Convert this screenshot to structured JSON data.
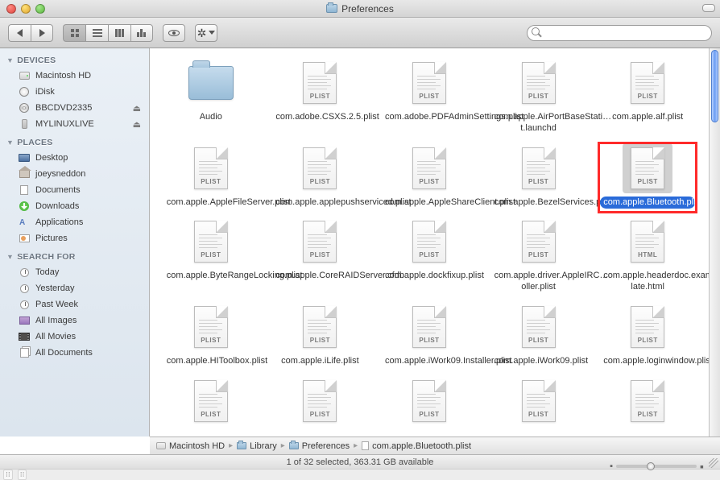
{
  "window": {
    "title": "Preferences"
  },
  "search": {
    "placeholder": ""
  },
  "sidebar": {
    "sections": [
      {
        "title": "DEVICES",
        "items": [
          {
            "label": "Macintosh HD",
            "icon": "hd",
            "eject": false
          },
          {
            "label": "iDisk",
            "icon": "idisk",
            "eject": false
          },
          {
            "label": "BBCDVD2335",
            "icon": "disc",
            "eject": true
          },
          {
            "label": "MYLINUXLIVE",
            "icon": "thumb",
            "eject": true
          }
        ]
      },
      {
        "title": "PLACES",
        "items": [
          {
            "label": "Desktop",
            "icon": "desktop"
          },
          {
            "label": "joeysneddon",
            "icon": "home"
          },
          {
            "label": "Documents",
            "icon": "docs"
          },
          {
            "label": "Downloads",
            "icon": "dl"
          },
          {
            "label": "Applications",
            "icon": "app"
          },
          {
            "label": "Pictures",
            "icon": "pic"
          }
        ]
      },
      {
        "title": "SEARCH FOR",
        "items": [
          {
            "label": "Today",
            "icon": "clock"
          },
          {
            "label": "Yesterday",
            "icon": "clock"
          },
          {
            "label": "Past Week",
            "icon": "clock"
          },
          {
            "label": "All Images",
            "icon": "img"
          },
          {
            "label": "All Movies",
            "icon": "mov"
          },
          {
            "label": "All Documents",
            "icon": "alldoc"
          }
        ]
      }
    ]
  },
  "files": [
    {
      "name": "Audio",
      "kind": "folder"
    },
    {
      "name": "com.adobe.CSXS.2.5.plist",
      "kind": "plist"
    },
    {
      "name": "com.adobe.PDFAdminSettings.plist",
      "kind": "plist"
    },
    {
      "name": "com.apple.AirPortBaseStati…t.launchd",
      "kind": "plist"
    },
    {
      "name": "com.apple.alf.plist",
      "kind": "plist"
    },
    {
      "name": "com.apple.AppleFileServer.plist",
      "kind": "plist"
    },
    {
      "name": "com.apple.applepushserviced.plist",
      "kind": "plist"
    },
    {
      "name": "com.apple.AppleShareClient.plist",
      "kind": "plist"
    },
    {
      "name": "com.apple.BezelServices.plist",
      "kind": "plist"
    },
    {
      "name": "com.apple.Bluetooth.plist",
      "kind": "plist",
      "selected": true,
      "highlighted": true
    },
    {
      "name": "com.apple.ByteRangeLocking.plist",
      "kind": "plist"
    },
    {
      "name": "com.apple.CoreRAIDServer.cfdb",
      "kind": "plist"
    },
    {
      "name": "com.apple.dockfixup.plist",
      "kind": "plist"
    },
    {
      "name": "com.apple.driver.AppleIRC…oller.plist",
      "kind": "plist"
    },
    {
      "name": "com.apple.headerdoc.exam…late.html",
      "kind": "html"
    },
    {
      "name": "com.apple.HIToolbox.plist",
      "kind": "plist"
    },
    {
      "name": "com.apple.iLife.plist",
      "kind": "plist"
    },
    {
      "name": "com.apple.iWork09.Installer.plist",
      "kind": "plist"
    },
    {
      "name": "com.apple.iWork09.plist",
      "kind": "plist"
    },
    {
      "name": "com.apple.loginwindow.plist",
      "kind": "plist"
    },
    {
      "name": "",
      "kind": "plist"
    },
    {
      "name": "",
      "kind": "plist"
    },
    {
      "name": "",
      "kind": "plist"
    },
    {
      "name": "",
      "kind": "plist"
    },
    {
      "name": "",
      "kind": "plist"
    }
  ],
  "pathbar": [
    {
      "label": "Macintosh HD",
      "icon": "hd"
    },
    {
      "label": "Library",
      "icon": "folder"
    },
    {
      "label": "Preferences",
      "icon": "folder"
    },
    {
      "label": "com.apple.Bluetooth.plist",
      "icon": "doc"
    }
  ],
  "status": {
    "text": "1 of 32 selected, 363.31 GB available"
  },
  "tags": {
    "plist": "PLIST",
    "html": "HTML"
  }
}
